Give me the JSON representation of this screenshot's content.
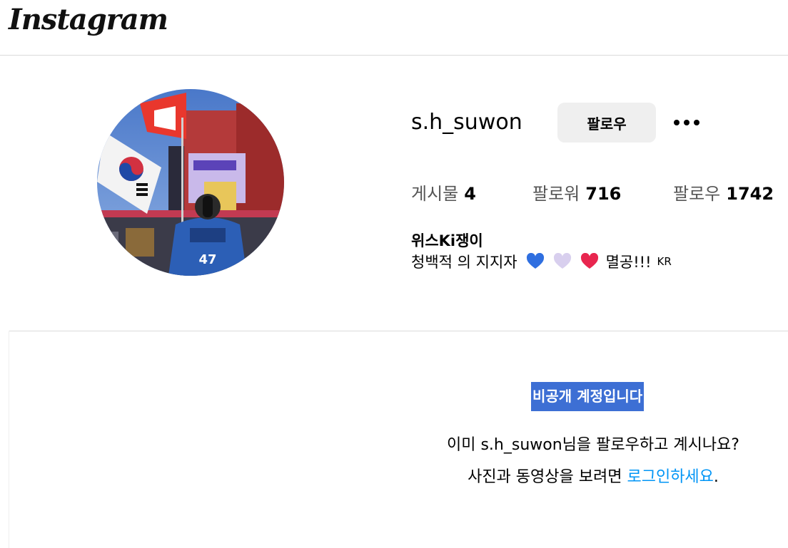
{
  "header": {
    "logo": "Instagram"
  },
  "profile": {
    "username": "s.h_suwon",
    "follow_button": "팔로우",
    "more_button": "more-options-icon",
    "stats": [
      {
        "label": "게시물",
        "value": "4"
      },
      {
        "label": "팔로워",
        "value": "716"
      },
      {
        "label": "팔로우",
        "value": "1742"
      }
    ],
    "bio_name": "위스Ki쟁이",
    "bio_text": "청백적 의 지지자",
    "bio_suffix": "멸공!!!",
    "bio_flag": "KR"
  },
  "private": {
    "title": "비공개 계정입니다",
    "message_prefix": "이미 s.h_suwon님을 팔로우하고 계시나요? 사진과 동영상을 보려면 ",
    "login_link": "로그인하세요",
    "message_suffix": "."
  },
  "colors": {
    "link": "#0095f6",
    "highlight": "#3d6fd4",
    "heart_blue": "#2f6fe0",
    "heart_white": "#d8cfee",
    "heart_red": "#e8264f"
  }
}
